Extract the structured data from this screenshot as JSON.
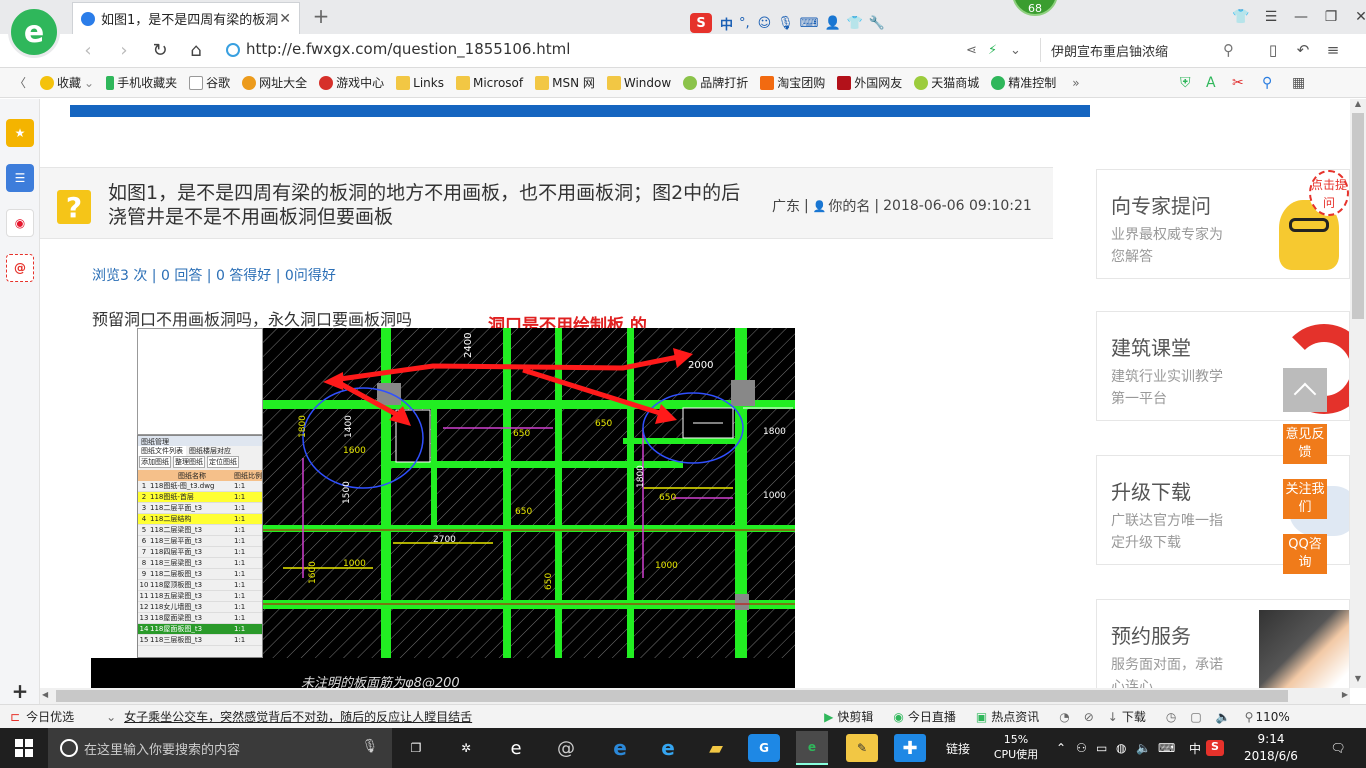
{
  "browser": {
    "tab_title": "如图1，是不是四周有梁的板洞的",
    "url": "http://e.fwxgx.com/question_1855106.html",
    "search_text": "伊朗宣布重启铀浓缩",
    "weather_badge": "68",
    "ime_label": "中"
  },
  "bookmarks": [
    "收藏",
    "手机收藏夹",
    "谷歌",
    "网址大全",
    "游戏中心",
    "Links",
    "Microsof",
    "MSN 网",
    "Window",
    "品牌打折",
    "淘宝团购",
    "外国网友",
    "天猫商城",
    "精准控制"
  ],
  "question": {
    "title": "如图1，是不是四周有梁的板洞的地方不用画板，也不用画板洞；图2中的后浇管井是不是不用画板洞但要画板",
    "region": "广东",
    "user": "你的名",
    "datetime": "2018-06-06 09:10:21",
    "stats": "浏览3 次 | 0 回答 | 0 答得好 | 0问得好",
    "answer_text": "预留洞口不用画板洞吗，永久洞口要画板洞吗",
    "annotation": "洞口是不用绘制板 的"
  },
  "cad": {
    "dims": [
      "2400",
      "2000",
      "1400",
      "1800",
      "1600",
      "650",
      "650",
      "1800",
      "1800",
      "650",
      "650",
      "1000",
      "1000",
      "2700",
      "650",
      "1000",
      "1600",
      "1500"
    ],
    "footer_text": "未注明的板面筋为φ8@200",
    "panel_title": "图纸管理",
    "panel_tabs": [
      "图纸文件列表",
      "图纸楼层对应"
    ],
    "panel_buttons": [
      "添加图纸",
      "整理图纸",
      "定位图纸"
    ],
    "panel_header": [
      "图纸名称",
      "图纸比例"
    ],
    "panel_rows": [
      {
        "n": "1",
        "name": "118图纸-图_t3.dwg",
        "scale": "1:1",
        "hl": "none"
      },
      {
        "n": "2",
        "name": "118图纸-首层",
        "scale": "1:1",
        "hl": "yellow"
      },
      {
        "n": "3",
        "name": "118二层平面_t3",
        "scale": "1:1",
        "hl": "none"
      },
      {
        "n": "4",
        "name": "118二层结构",
        "scale": "1:1",
        "hl": "yellow"
      },
      {
        "n": "5",
        "name": "118二层梁图_t3",
        "scale": "1:1",
        "hl": "none"
      },
      {
        "n": "6",
        "name": "118三层平面_t3",
        "scale": "1:1",
        "hl": "none"
      },
      {
        "n": "7",
        "name": "118四层平面_t3",
        "scale": "1:1",
        "hl": "none"
      },
      {
        "n": "8",
        "name": "118三层梁图_t3",
        "scale": "1:1",
        "hl": "none"
      },
      {
        "n": "9",
        "name": "118二层板图_t3",
        "scale": "1:1",
        "hl": "none"
      },
      {
        "n": "10",
        "name": "118屋顶板图_t3",
        "scale": "1:1",
        "hl": "none"
      },
      {
        "n": "11",
        "name": "118五层梁图_t3",
        "scale": "1:1",
        "hl": "none"
      },
      {
        "n": "12",
        "name": "118女儿墙图_t3",
        "scale": "1:1",
        "hl": "none"
      },
      {
        "n": "13",
        "name": "118屋面梁图_t3",
        "scale": "1:1",
        "hl": "none"
      },
      {
        "n": "14",
        "name": "118屋面板图_t3",
        "scale": "1:1",
        "hl": "green"
      },
      {
        "n": "15",
        "name": "118三层板图_t3",
        "scale": "1:1",
        "hl": "none"
      }
    ]
  },
  "right_cards": [
    {
      "title": "向专家提问",
      "sub": "业界最权威专家为您解答",
      "badge": "点击提问"
    },
    {
      "title": "建筑课堂",
      "sub": "建筑行业实训教学第一平台"
    },
    {
      "title": "升级下载",
      "sub": "广联达官方唯一指定升级下载"
    },
    {
      "title": "预约服务",
      "sub": "服务面对面，承诺心连心"
    }
  ],
  "float_buttons": [
    "意见反馈",
    "关注我们",
    "QQ咨询"
  ],
  "statusbar": {
    "left": "今日优选",
    "news": "女子乘坐公交车，突然感觉背后不对劲，随后的反应让人瞠目结舌",
    "items": [
      "快剪辑",
      "今日直播",
      "热点资讯",
      "下载"
    ],
    "zoom": "110%"
  },
  "taskbar": {
    "search_placeholder": "在这里输入你要搜索的内容",
    "link_label": "链接",
    "cpu_percent": "15%",
    "cpu_label": "CPU使用",
    "ime": "中",
    "time": "9:14",
    "date": "2018/6/6"
  },
  "colors": {
    "accent_green": "#2fb75b",
    "link_blue": "#2b6fb6",
    "annotation_red": "#e02020",
    "float_orange": "#f07b1a",
    "cad_green": "#22ee22"
  }
}
